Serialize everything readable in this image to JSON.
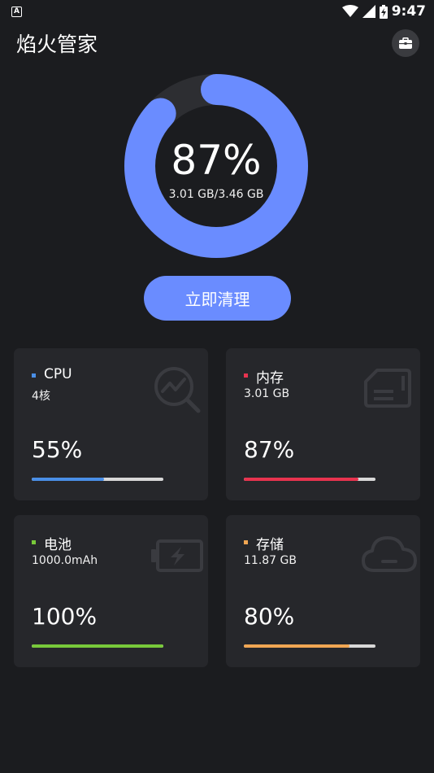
{
  "status_bar": {
    "time": "9:47"
  },
  "header": {
    "title": "焰火管家"
  },
  "gauge": {
    "percent_label": "87%",
    "percent": 87,
    "detail": "3.01 GB/3.46 GB",
    "color": "#6a8cff"
  },
  "clean_button": {
    "label": "立即清理"
  },
  "cards": [
    {
      "title": "CPU",
      "subtitle": "4核",
      "value": "55%",
      "percent": 55,
      "color": "#4a8fe7",
      "icon": "chart-search-icon"
    },
    {
      "title": "内存",
      "subtitle": "3.01 GB",
      "value": "87%",
      "percent": 87,
      "color": "#e8334f",
      "icon": "sd-card-icon"
    },
    {
      "title": "电池",
      "subtitle": "1000.0mAh",
      "value": "100%",
      "percent": 100,
      "color": "#78c93a",
      "icon": "battery-charging-icon"
    },
    {
      "title": "存储",
      "subtitle": "11.87 GB",
      "value": "80%",
      "percent": 80,
      "color": "#f0a653",
      "icon": "cloud-icon"
    }
  ]
}
